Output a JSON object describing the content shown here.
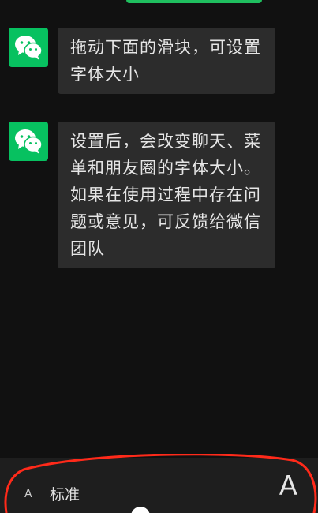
{
  "messages": [
    {
      "text": "拖动下面的滑块，可设置字体大小"
    },
    {
      "text": "设置后，会改变聊天、菜单和朋友圈的字体大小。如果在使用过程中存在问题或意见，可反馈给微信团队"
    }
  ],
  "font_slider": {
    "small_label": "A",
    "current_label": "标准",
    "large_label": "A"
  },
  "colors": {
    "background": "#111111",
    "bubble": "#2c2c2c",
    "avatar": "#07c160",
    "annotation": "#ff2a1a"
  },
  "icons": {
    "avatar": "wechat-logo-icon"
  }
}
